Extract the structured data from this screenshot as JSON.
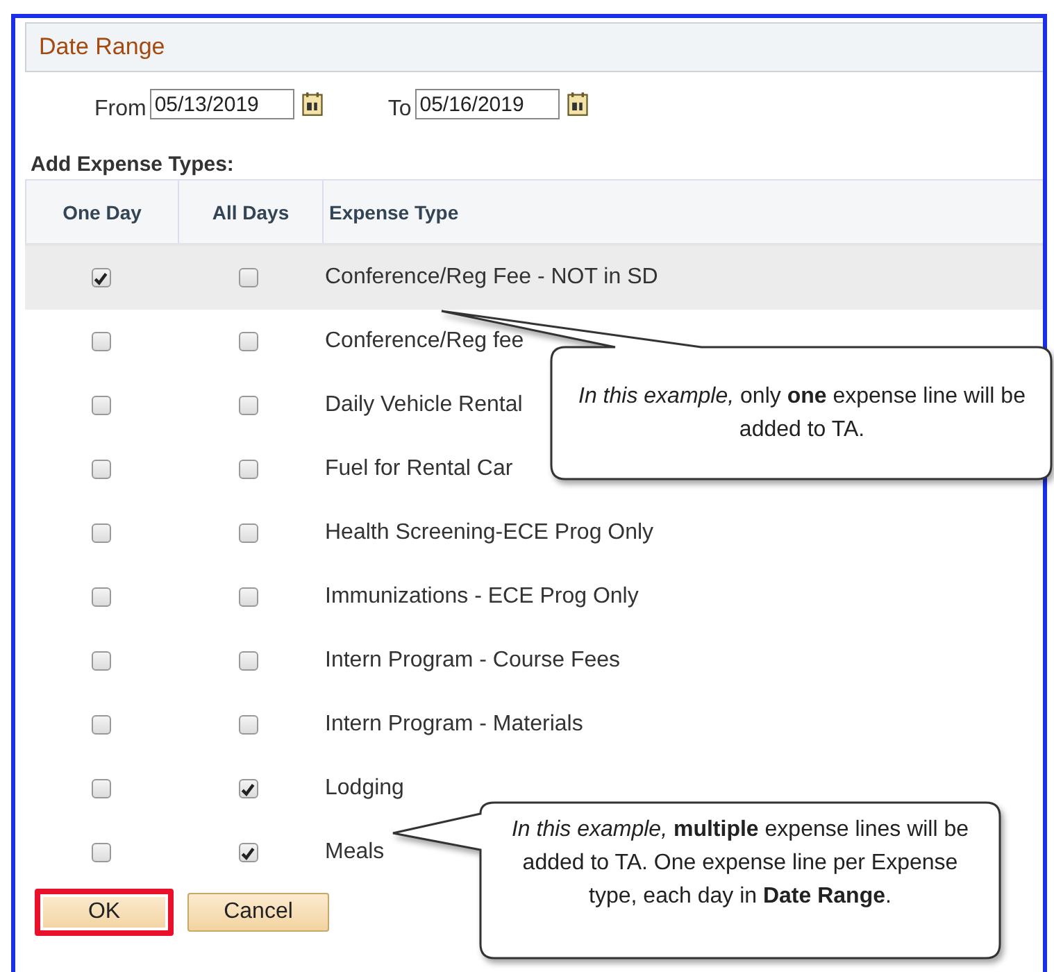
{
  "panel": {
    "title": "Date Range"
  },
  "dates": {
    "from_label": "From",
    "from_value": "05/13/2019",
    "to_label": "To",
    "to_value": "05/16/2019"
  },
  "section_label": "Add Expense Types:",
  "table": {
    "columns": [
      "One Day",
      "All Days",
      "Expense Type"
    ],
    "rows": [
      {
        "one_day": true,
        "all_days": false,
        "expense_type": "Conference/Reg Fee - NOT in SD",
        "selected": true
      },
      {
        "one_day": false,
        "all_days": false,
        "expense_type": "Conference/Reg fee",
        "selected": false
      },
      {
        "one_day": false,
        "all_days": false,
        "expense_type": "Daily Vehicle Rental",
        "selected": false
      },
      {
        "one_day": false,
        "all_days": false,
        "expense_type": "Fuel for Rental Car",
        "selected": false
      },
      {
        "one_day": false,
        "all_days": false,
        "expense_type": "Health Screening-ECE Prog Only",
        "selected": false
      },
      {
        "one_day": false,
        "all_days": false,
        "expense_type": "Immunizations - ECE Prog Only",
        "selected": false
      },
      {
        "one_day": false,
        "all_days": false,
        "expense_type": "Intern Program - Course Fees",
        "selected": false
      },
      {
        "one_day": false,
        "all_days": false,
        "expense_type": "Intern Program - Materials",
        "selected": false
      },
      {
        "one_day": false,
        "all_days": true,
        "expense_type": "Lodging",
        "selected": false
      },
      {
        "one_day": false,
        "all_days": true,
        "expense_type": "Meals",
        "selected": false
      }
    ]
  },
  "buttons": [
    {
      "label": "OK",
      "highlighted": true
    },
    {
      "label": "Cancel",
      "highlighted": false
    }
  ],
  "callouts": [
    "*In this example,* only **one** expense line will be added to TA.",
    "*In this example,* **multiple** expense lines will be added to TA. One expense line per Expense type, each day in **Date Range**."
  ]
}
